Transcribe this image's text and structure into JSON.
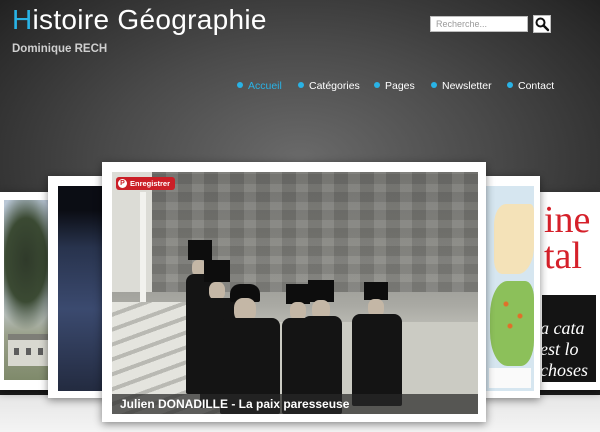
{
  "site": {
    "title_first_letter": "H",
    "title_rest": "istoire Géographie",
    "subtitle": "Dominique RECH"
  },
  "search": {
    "placeholder": "Recherche..."
  },
  "nav": {
    "items": [
      {
        "label": "Accueil",
        "active": true
      },
      {
        "label": "Catégories",
        "active": false
      },
      {
        "label": "Pages",
        "active": false
      },
      {
        "label": "Newsletter",
        "active": false
      },
      {
        "label": "Contact",
        "active": false
      }
    ]
  },
  "slider": {
    "main_caption": "Julien DONADILLE - La paix paresseuse",
    "save_label": "Enregistrer",
    "magazine_red_text": "ine\ntal",
    "magazine_white_text": "a cata\nest lo\nchoses\nr co"
  },
  "colors": {
    "accent": "#29b3e6",
    "pinterest_red": "#cb1f27"
  },
  "icons": {
    "search": "magnifier-icon",
    "pinterest": "pinterest-icon",
    "nav_bullet": "bullet-icon"
  }
}
